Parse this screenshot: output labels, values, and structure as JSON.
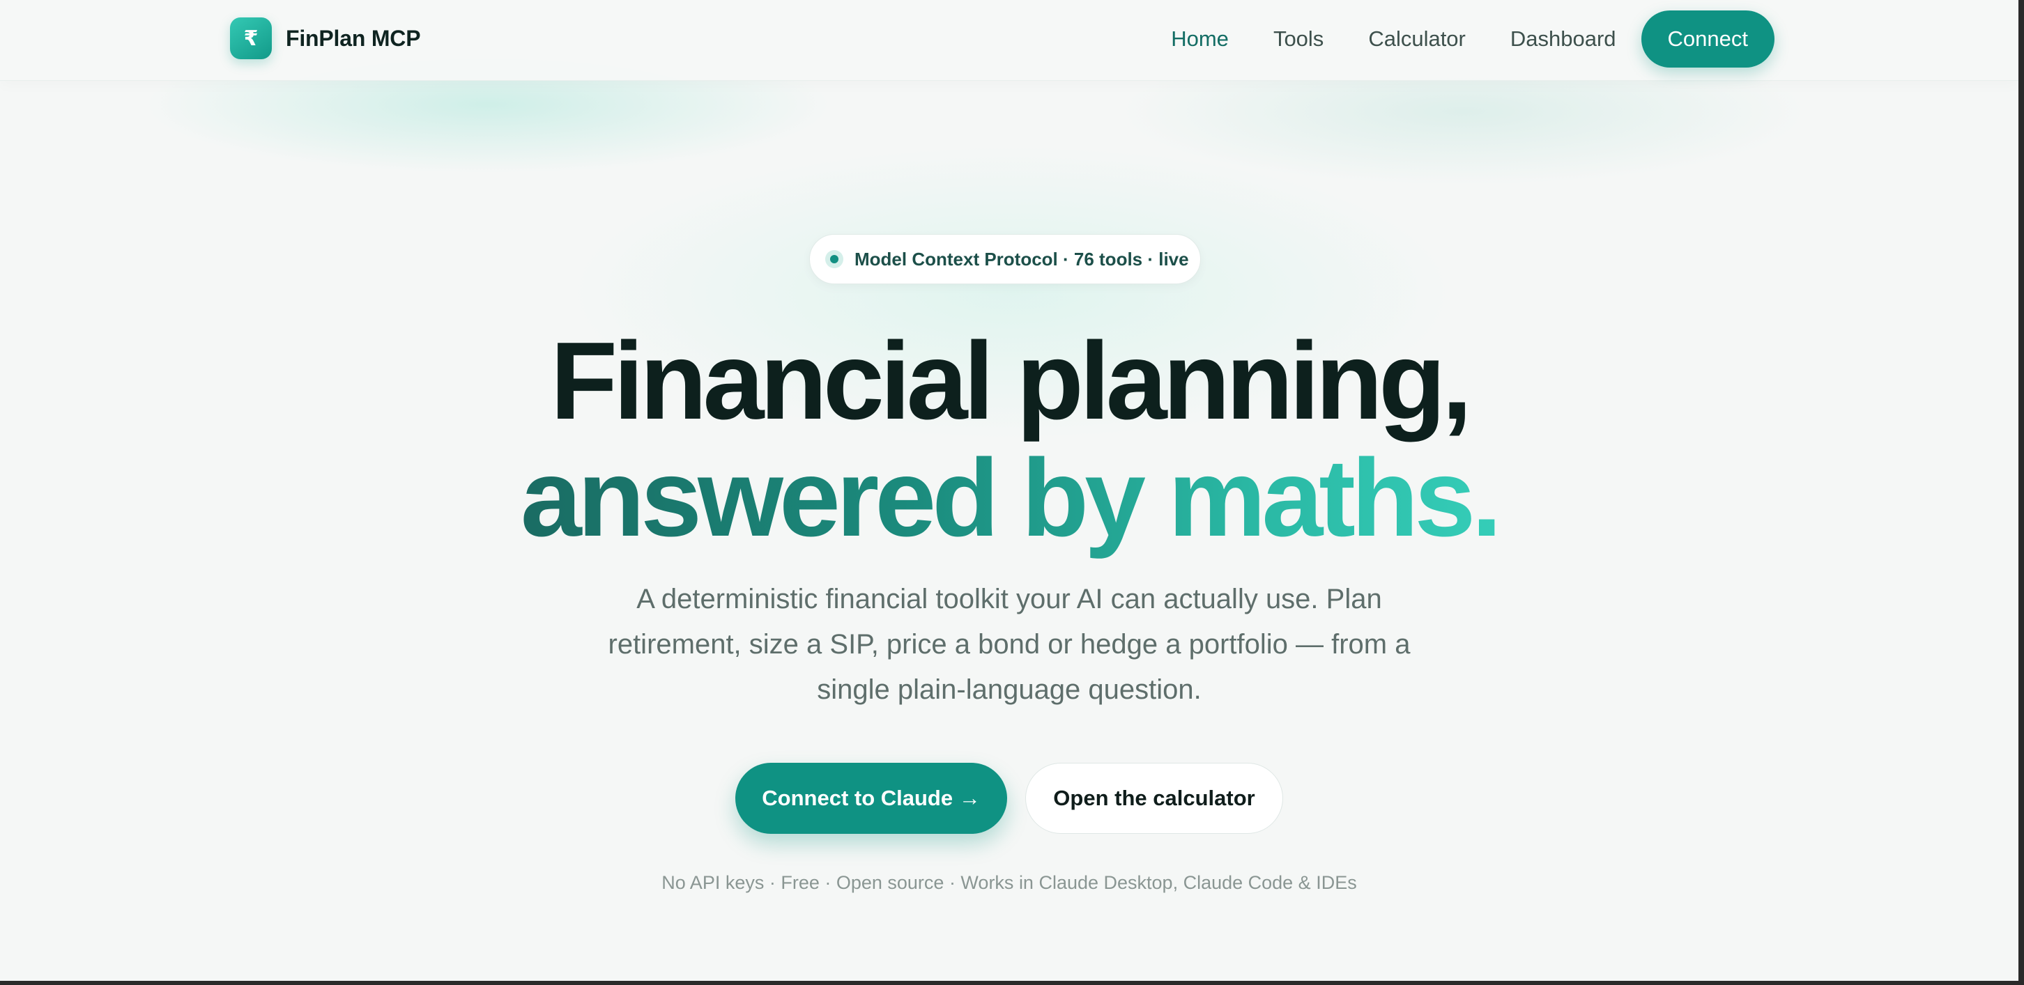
{
  "brand": {
    "logo_glyph": "₹",
    "name": "FinPlan MCP"
  },
  "nav": {
    "items": [
      {
        "label": "Home",
        "active": true
      },
      {
        "label": "Tools",
        "active": false
      },
      {
        "label": "Calculator",
        "active": false
      },
      {
        "label": "Dashboard",
        "active": false
      }
    ],
    "connect_label": "Connect"
  },
  "hero": {
    "badge": "Model Context Protocol · 76 tools · live",
    "title_line1": "Financial planning,",
    "title_line2": "answered by maths.",
    "subtitle": "A deterministic financial toolkit your AI can actually use. Plan retirement, size a SIP, price a bond or hedge a portfolio — from a single plain-language question.",
    "primary_cta": "Connect to Claude →",
    "secondary_cta": "Open the calculator",
    "footnote": "No API keys · Free · Open source · Works in Claude Desktop, Claude Code & IDEs"
  },
  "colors": {
    "accent": "#0f9283",
    "accent_light": "#35cdb8",
    "heading": "#0d201d",
    "muted": "#5e6e6b"
  }
}
